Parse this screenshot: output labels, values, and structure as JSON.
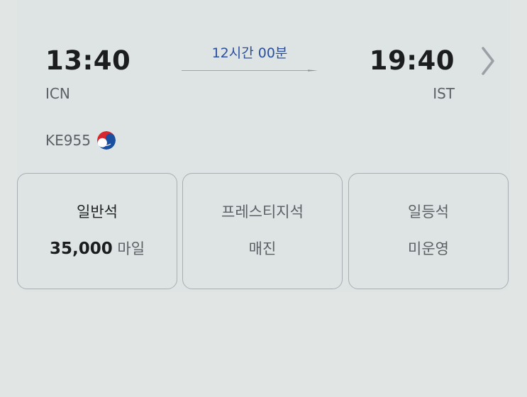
{
  "flight": {
    "departure_time": "13:40",
    "departure_airport": "ICN",
    "arrival_time": "19:40",
    "arrival_airport": "IST",
    "duration": "12시간 00분",
    "flight_number": "KE955",
    "airline_logo_icon": "korean-air-taeguk-logo"
  },
  "fares": [
    {
      "class": "일반석",
      "amount": "35,000",
      "unit": "마일"
    },
    {
      "class": "프레스티지석",
      "status": "매진"
    },
    {
      "class": "일등석",
      "status": "미운영"
    }
  ],
  "colors": {
    "duration_text": "#2a4fa0",
    "logo_red": "#d7282f",
    "logo_blue": "#1a4fa0"
  }
}
